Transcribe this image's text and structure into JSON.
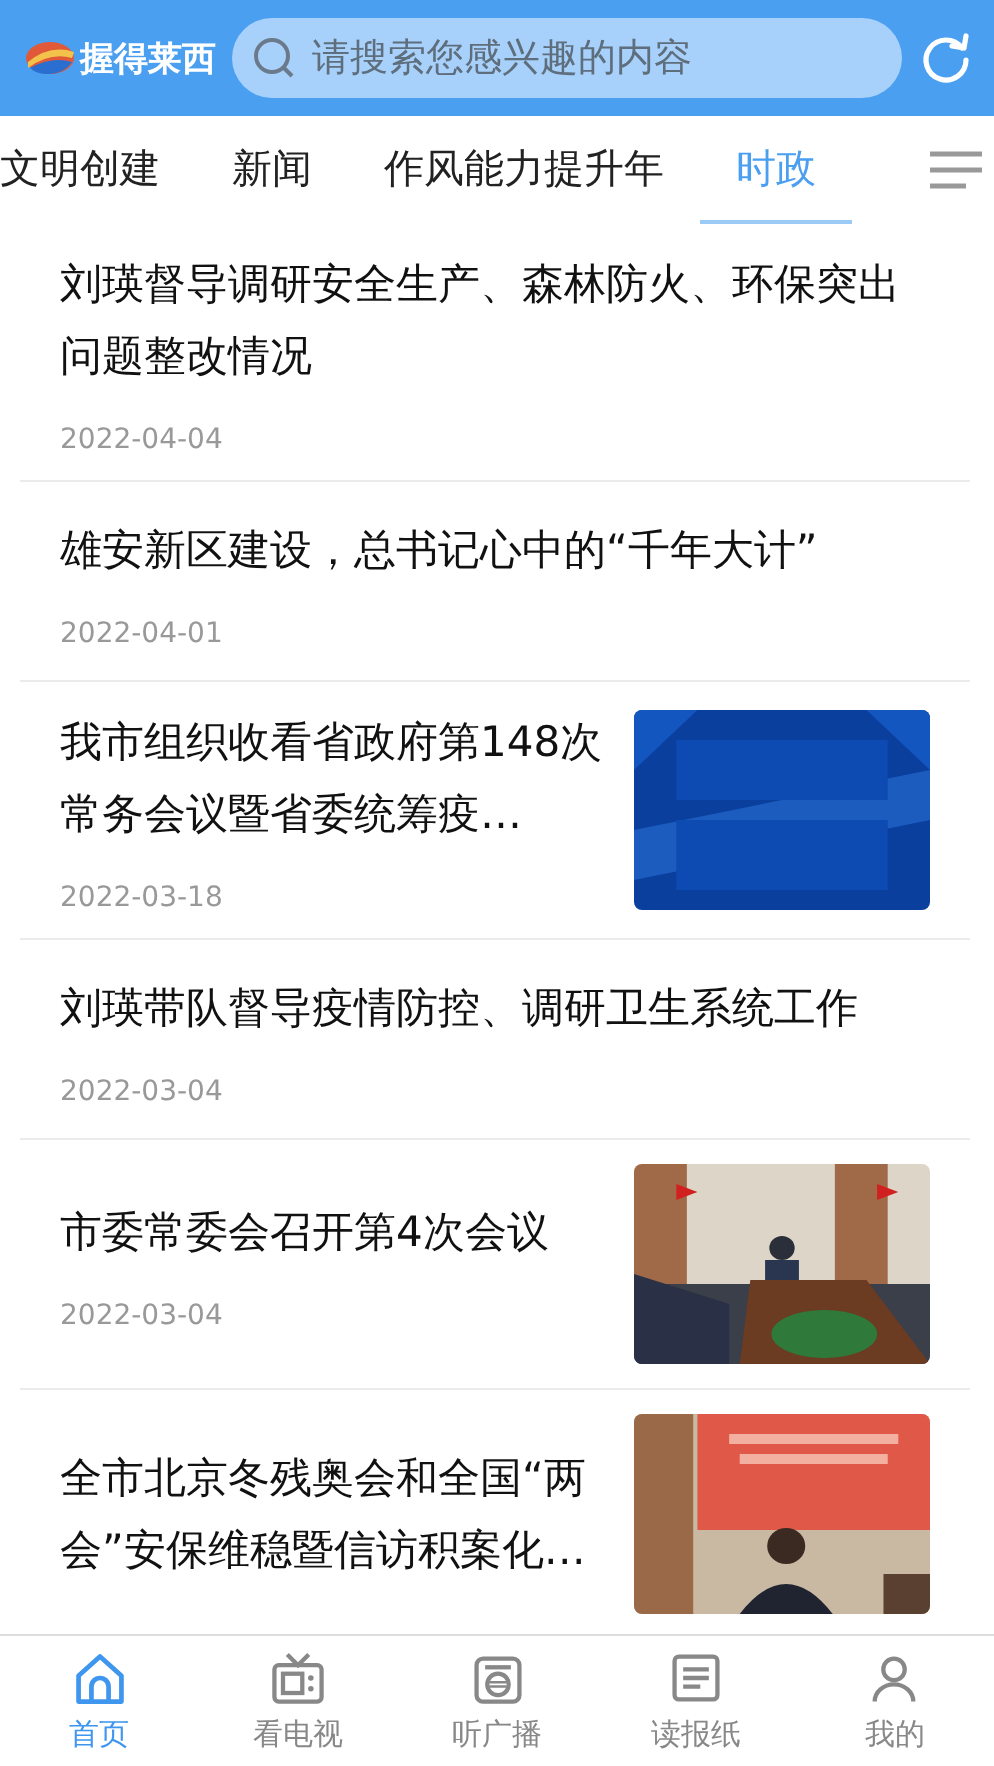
{
  "header": {
    "logo_text": "握得莱西",
    "search": {
      "placeholder": "请搜索您感兴趣的内容"
    }
  },
  "tabs": [
    {
      "label": "文明创建",
      "selected": false
    },
    {
      "label": "新闻",
      "selected": false
    },
    {
      "label": "作风能力提升年",
      "selected": false
    },
    {
      "label": "时政",
      "selected": true
    }
  ],
  "articles": [
    {
      "title": "刘瑛督导调研安全生产、森林防火、环保突出问题整改情况",
      "date": "2022-04-04"
    },
    {
      "title": "雄安新区建设，总书记心中的“千年大计”",
      "date": "2022-04-01"
    },
    {
      "title": "我市组织收看省政府第148次常务会议暨省委统筹疫…",
      "date": "2022-03-18"
    },
    {
      "title": "刘瑛带队督导疫情防控、调研卫生系统工作",
      "date": "2022-03-04"
    },
    {
      "title": "市委常委会召开第4次会议",
      "date": "2022-03-04"
    },
    {
      "title": "全市北京冬残奥会和全国“两会”安保维稳暨信访积案化…"
    }
  ],
  "bottom_nav": [
    {
      "label": "首页",
      "selected": true
    },
    {
      "label": "看电视",
      "selected": false
    },
    {
      "label": "听广播",
      "selected": false
    },
    {
      "label": "读报纸",
      "selected": false
    },
    {
      "label": "我的",
      "selected": false
    }
  ]
}
